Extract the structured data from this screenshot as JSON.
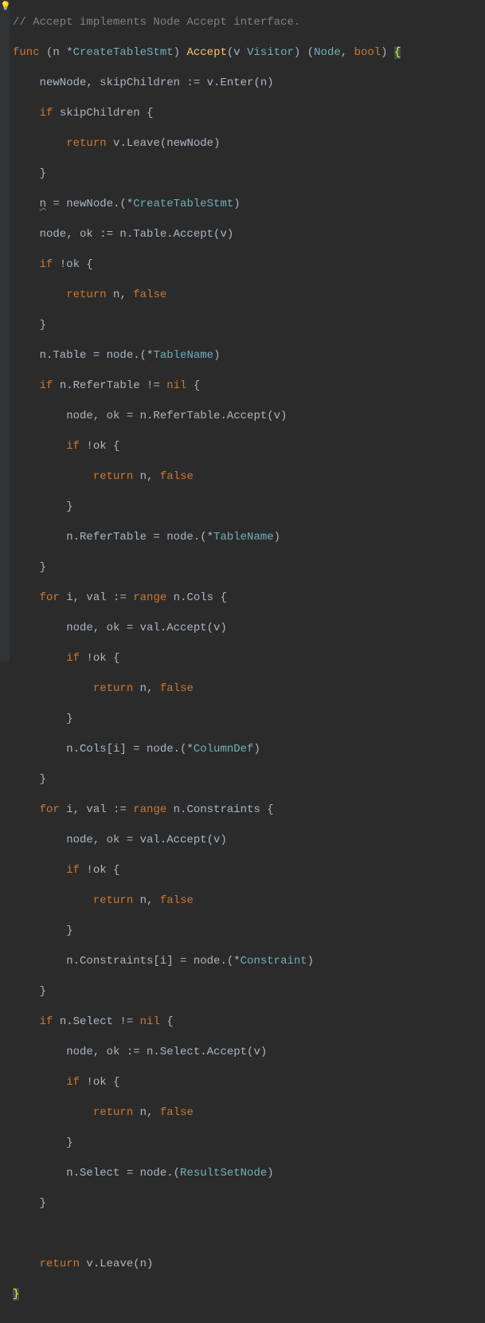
{
  "comment": "// Accept implements Node Accept interface.",
  "sig": {
    "func": "func",
    "recv_open": " (n *",
    "recv_type": "CreateTableStmt",
    "recv_close": ") ",
    "name": "Accept",
    "params_open": "(v ",
    "param_type": "Visitor",
    "params_close": ") (",
    "ret1": "Node",
    "ret_sep": ", ",
    "ret2": "bool",
    "ret_close": ") ",
    "brace": "{"
  },
  "l": {
    "l1": "    newNode, skipChildren := v.Enter(n)",
    "l2a": "    ",
    "l2b": "if",
    "l2c": " skipChildren {",
    "l3a": "        ",
    "l3b": "return",
    "l3c": " v.Leave(newNode)",
    "l4": "    }",
    "l5a": "    ",
    "l5n": "n",
    "l5b": " = newNode.(*",
    "l5c": "CreateTableStmt",
    "l5d": ")",
    "l6": "    node, ok := n.Table.Accept(v)",
    "l7a": "    ",
    "l7b": "if",
    "l7c": " !ok {",
    "l8a": "        ",
    "l8b": "return",
    "l8c": " n, ",
    "l8d": "false",
    "l9": "    }",
    "l10a": "    n.Table = node.(*",
    "l10b": "TableName",
    "l10c": ")",
    "l11a": "    ",
    "l11b": "if",
    "l11c": " n.ReferTable != ",
    "l11d": "nil",
    "l11e": " {",
    "l12": "        node, ok = n.ReferTable.Accept(v)",
    "l13a": "        ",
    "l13b": "if",
    "l13c": " !ok {",
    "l14a": "            ",
    "l14b": "return",
    "l14c": " n, ",
    "l14d": "false",
    "l15": "        }",
    "l16a": "        n.ReferTable = node.(*",
    "l16b": "TableName",
    "l16c": ")",
    "l17": "    }",
    "l18a": "    ",
    "l18b": "for",
    "l18c": " i, val := ",
    "l18d": "range",
    "l18e": " n.Cols {",
    "l19": "        node, ok = val.Accept(v)",
    "l20a": "        ",
    "l20b": "if",
    "l20c": " !ok {",
    "l21a": "            ",
    "l21b": "return",
    "l21c": " n, ",
    "l21d": "false",
    "l22": "        }",
    "l23a": "        n.Cols[i] = node.(*",
    "l23b": "ColumnDef",
    "l23c": ")",
    "l24": "    }",
    "l25a": "    ",
    "l25b": "for",
    "l25c": " i, val := ",
    "l25d": "range",
    "l25e": " n.Constraints {",
    "l26": "        node, ok = val.Accept(v)",
    "l27a": "        ",
    "l27b": "if",
    "l27c": " !ok {",
    "l28a": "            ",
    "l28b": "return",
    "l28c": " n, ",
    "l28d": "false",
    "l29": "        }",
    "l30a": "        n.Constraints[i] = node.(*",
    "l30b": "Constraint",
    "l30c": ")",
    "l31": "    }",
    "l32a": "    ",
    "l32b": "if",
    "l32c": " n.Select != ",
    "l32d": "nil",
    "l32e": " {",
    "l33": "        node, ok := n.Select.Accept(v)",
    "l34a": "        ",
    "l34b": "if",
    "l34c": " !ok {",
    "l35a": "            ",
    "l35b": "return",
    "l35c": " n, ",
    "l35d": "false",
    "l36": "        }",
    "l37a": "        n.Select = node.(",
    "l37b": "ResultSetNode",
    "l37c": ")",
    "l38": "    }",
    "l39": "",
    "l40a": "    ",
    "l40b": "return",
    "l40c": " v.Leave(n)",
    "l41": "}"
  }
}
